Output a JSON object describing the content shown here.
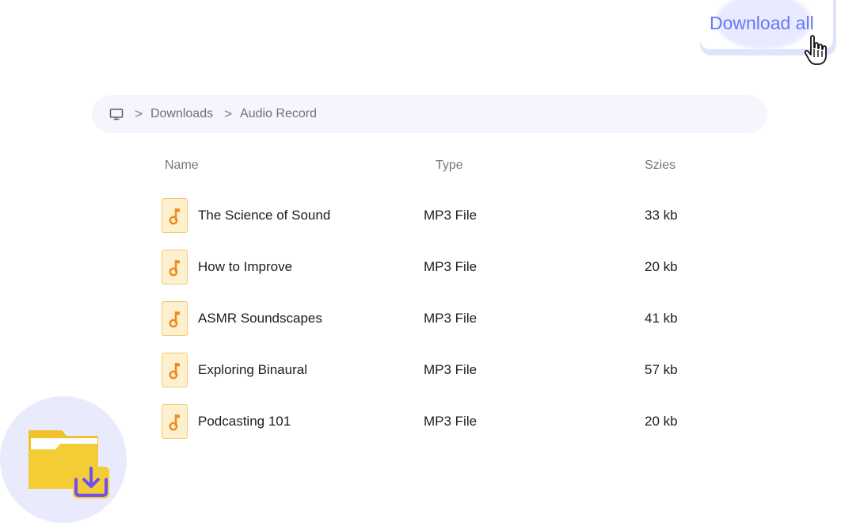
{
  "actions": {
    "download_all_label": "Download all"
  },
  "breadcrumb": {
    "root_icon": "monitor-icon",
    "separator": ">",
    "items": [
      "Downloads",
      "Audio Record"
    ]
  },
  "table": {
    "headers": {
      "name": "Name",
      "type": "Type",
      "size": "Szies"
    },
    "rows": [
      {
        "name": "The Science of Sound",
        "type": "MP3 File",
        "size": "33 kb",
        "icon": "music-note-icon"
      },
      {
        "name": "How to Improve",
        "type": "MP3 File",
        "size": "20 kb",
        "icon": "music-note-icon"
      },
      {
        "name": "ASMR Soundscapes",
        "type": "MP3 File",
        "size": "41 kb",
        "icon": "music-note-icon"
      },
      {
        "name": "Exploring Binaural",
        "type": "MP3 File",
        "size": "57 kb",
        "icon": "music-note-icon"
      },
      {
        "name": "Podcasting 101",
        "type": "MP3 File",
        "size": "20 kb",
        "icon": "music-note-icon"
      }
    ]
  },
  "decor": {
    "folder_icon": "folder-download-icon",
    "cursor_icon": "hand-pointer-icon"
  },
  "colors": {
    "accent": "#6a78f3",
    "file_icon_bg": "#fdf0cf",
    "music_note": "#f08a1c",
    "folder": "#f4cc35",
    "download_arrow": "#6f4ff0"
  }
}
